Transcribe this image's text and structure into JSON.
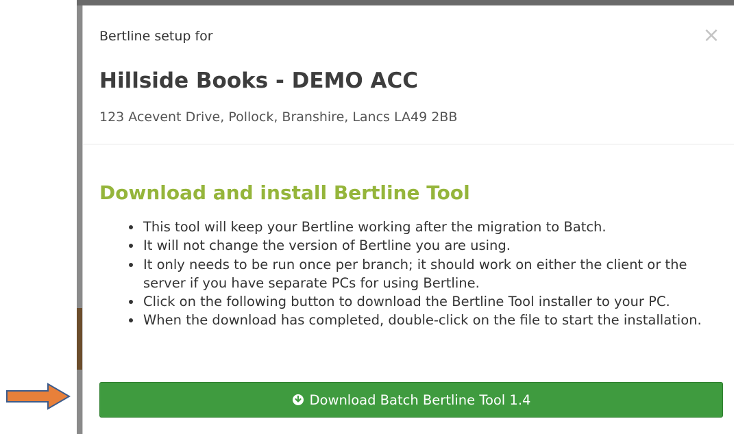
{
  "modal": {
    "setup_label": "Bertline setup for",
    "close_glyph": "×",
    "company_name": "Hillside Books - DEMO ACC",
    "address": "123 Acevent Drive, Pollock, Branshire, Lancs  LA49 2BB",
    "section_title": "Download and install Bertline Tool",
    "steps": [
      "This tool will keep your Bertline working after the migration to Batch.",
      "It will not change the version of Bertline you are using.",
      "It only needs to be run once per branch; it should work on either the client or the server if you have separate PCs for using Bertline.",
      "Click on the following button to download the Bertline Tool installer to your PC.",
      "When the download has completed, double-click on the file to start the installation."
    ],
    "download_button_label": "Download Batch Bertline Tool 1.4"
  },
  "icons": {
    "download": "circle-arrow-down-icon",
    "close": "close-icon",
    "pointer": "arrow-right-icon"
  },
  "colors": {
    "section_title": "#95b53b",
    "button_bg": "#3f9b3f",
    "arrow_fill": "#e8803a",
    "arrow_stroke": "#3b5b8c"
  }
}
